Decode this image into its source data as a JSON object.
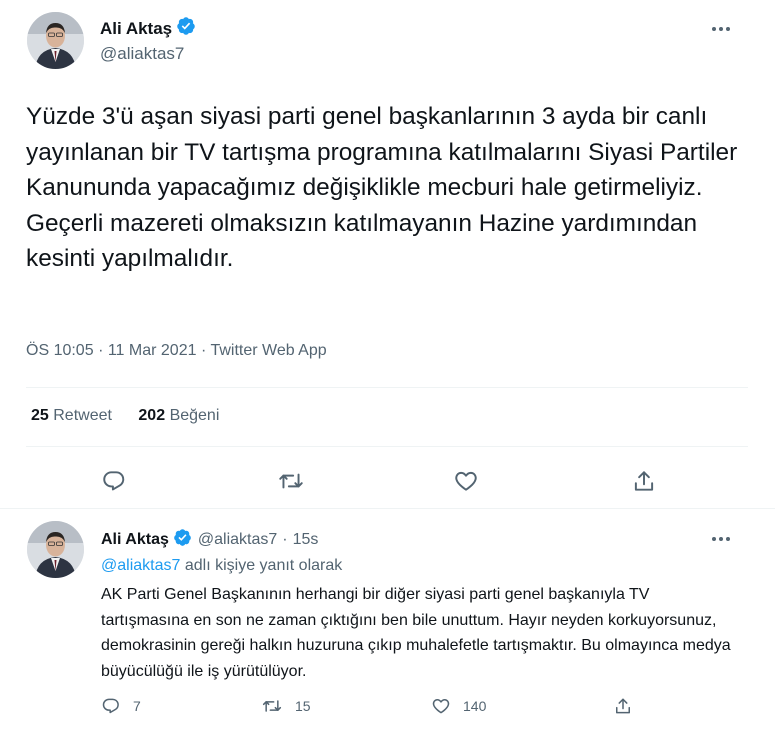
{
  "main_tweet": {
    "author_name": "Ali Aktaş",
    "author_handle": "@aliaktas7",
    "text": "Yüzde 3'ü aşan siyasi parti genel başkanlarının 3 ayda bir canlı yayınlanan bir TV tartışma programına katılmalarını Siyasi Partiler Kanununda yapacağımız değişiklikle mecburi hale getirmeliyiz. Geçerli mazereti olmaksızın katılmayanın Hazine yardımından kesinti yapılmalıdır.",
    "time": "ÖS 10:05",
    "separator": "·",
    "date": "11 Mar 2021",
    "source": "Twitter Web App",
    "retweet_count": "25",
    "retweet_label": "Retweet",
    "like_count": "202",
    "like_label": "Beğeni"
  },
  "reply_tweet": {
    "author_name": "Ali Aktaş",
    "author_handle": "@aliaktas7",
    "separator": "·",
    "time_ago": "15s",
    "replying_to_handle": "@aliaktas7",
    "replying_suffix": "adlı kişiye yanıt olarak",
    "text": "AK Parti Genel Başkanının herhangi bir diğer siyasi parti genel başkanıyla TV tartışmasına en son ne zaman çıktığını ben bile unuttum. Hayır neyden korkuyorsunuz, demokrasinin gereği halkın huzuruna çıkıp muhalefetle tartışmaktır. Bu olmayınca medya büyücülüğü ile iş yürütülüyor.",
    "reply_count": "7",
    "retweet_count": "15",
    "like_count": "140"
  },
  "icons": {
    "verified": "verified-badge-icon",
    "more": "more-dots-icon",
    "reply": "reply-bubble-icon",
    "retweet": "retweet-icon",
    "like": "heart-icon",
    "share": "share-icon"
  },
  "colors": {
    "accent": "#1d9bf0",
    "text_primary": "#0f1419",
    "text_secondary": "#536471",
    "divider": "#eff3f4"
  }
}
